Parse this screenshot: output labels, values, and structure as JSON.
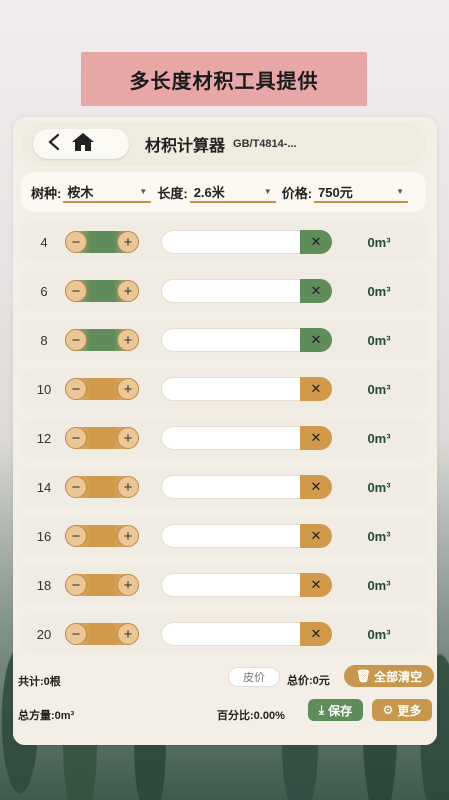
{
  "banner": {
    "title": "多长度材积工具提供"
  },
  "header": {
    "title": "材积计算器",
    "subtitle": "GB/T4814-..."
  },
  "filters": {
    "species_label": "树种:",
    "species_value": "桉木",
    "length_label": "长度:",
    "length_value": "2.6米",
    "price_label": "价格:",
    "price_value": "750元"
  },
  "rows": [
    {
      "length": "4",
      "volume": "0m³",
      "style": "green"
    },
    {
      "length": "6",
      "volume": "0m³",
      "style": "green"
    },
    {
      "length": "8",
      "volume": "0m³",
      "style": "green"
    },
    {
      "length": "10",
      "volume": "0m³",
      "style": "gold"
    },
    {
      "length": "12",
      "volume": "0m³",
      "style": "gold"
    },
    {
      "length": "14",
      "volume": "0m³",
      "style": "gold"
    },
    {
      "length": "16",
      "volume": "0m³",
      "style": "gold"
    },
    {
      "length": "18",
      "volume": "0m³",
      "style": "gold"
    },
    {
      "length": "20",
      "volume": "0m³",
      "style": "gold"
    }
  ],
  "footer": {
    "count": "共计:0根",
    "peel_placeholder": "皮价",
    "total_price": "总价:0元",
    "clear_label": "全部清空",
    "total_volume": "总方量:0m³",
    "percent": "百分比:0.00%",
    "save_label": "保存",
    "more_label": "更多"
  },
  "colors": {
    "green": "#5f8c5a",
    "gold": "#d09a4a",
    "banner": "#e8a7a7"
  }
}
